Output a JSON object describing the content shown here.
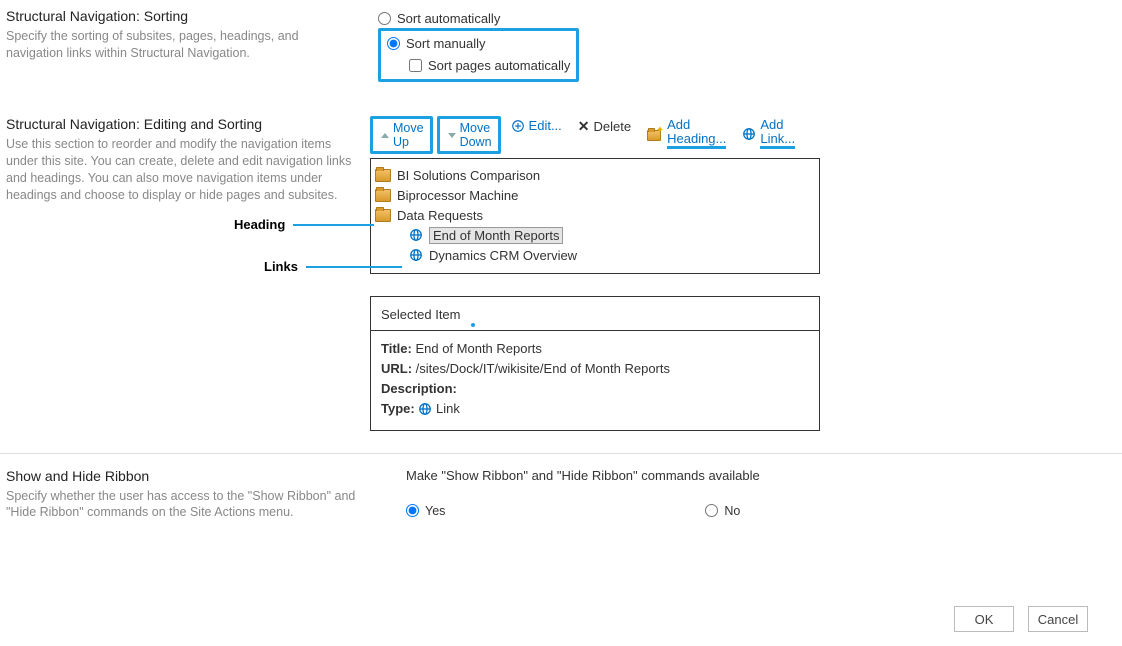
{
  "sorting": {
    "title": "Structural Navigation: Sorting",
    "desc": "Specify the sorting of subsites, pages, headings, and navigation links within Structural Navigation.",
    "auto_label": "Sort automatically",
    "manual_label": "Sort manually",
    "pages_auto_label": "Sort pages automatically"
  },
  "editing": {
    "title": "Structural Navigation: Editing and Sorting",
    "desc": "Use this section to reorder and modify the navigation items under this site. You can create, delete and edit navigation links and headings. You can also move navigation items under headings and choose to display or hide pages and subsites.",
    "move_up": "Move\nUp",
    "move_down": "Move\nDown",
    "edit": "Edit...",
    "delete": "Delete",
    "add_heading": "Add\nHeading...",
    "add_link": "Add\nLink..."
  },
  "tree": {
    "items": [
      {
        "label": "BI Solutions Comparison"
      },
      {
        "label": "Biprocessor Machine"
      },
      {
        "label": "Data Requests"
      }
    ],
    "selected_child": "End of Month Reports",
    "link_child": "Dynamics CRM Overview"
  },
  "annotations": {
    "heading": "Heading",
    "links": "Links"
  },
  "detail": {
    "header": "Selected Item",
    "title_lbl": "Title:",
    "title_val": "End of Month Reports",
    "url_lbl": "URL:",
    "url_val": "/sites/Dock/IT/wikisite/End of Month Reports",
    "desc_lbl": "Description:",
    "type_lbl": "Type:",
    "type_val": "Link"
  },
  "ribbon": {
    "title": "Show and Hide Ribbon",
    "desc": "Specify whether the user has access to the \"Show Ribbon\" and \"Hide Ribbon\" commands on the Site Actions menu.",
    "prompt": "Make \"Show Ribbon\" and \"Hide Ribbon\" commands available",
    "yes": "Yes",
    "no": "No"
  },
  "footer": {
    "ok": "OK",
    "cancel": "Cancel"
  }
}
